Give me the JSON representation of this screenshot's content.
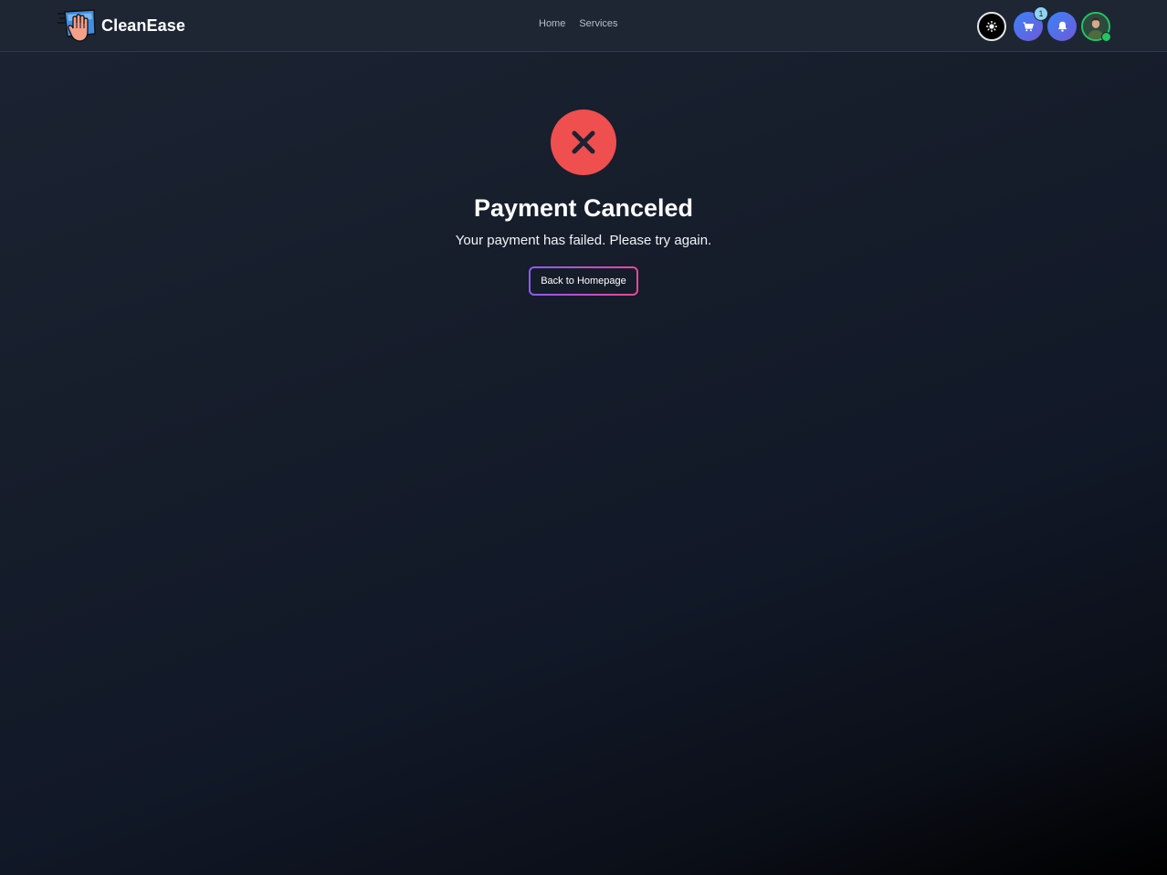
{
  "header": {
    "brand_name": "CleanEase",
    "nav": [
      {
        "label": "Home"
      },
      {
        "label": "Services"
      }
    ],
    "cart_count": "1"
  },
  "icons": {
    "logo": "cleaning-hand-icon",
    "theme": "sun-icon",
    "cart": "cart-icon",
    "notifications": "bell-icon",
    "avatar": "user-avatar",
    "status": "x-icon"
  },
  "colors": {
    "error": "#ef4f4f",
    "accent_start": "#8b5cf6",
    "accent_end": "#ec4899",
    "online": "#22c55e"
  },
  "main": {
    "title": "Payment Canceled",
    "message": "Your payment has failed. Please try again.",
    "back_button": "Back to Homepage"
  }
}
